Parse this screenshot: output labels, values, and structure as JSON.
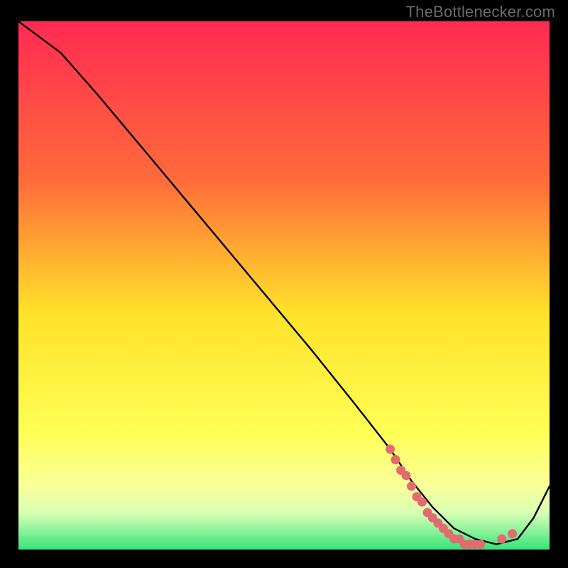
{
  "attribution": "TheBottlenecker.com",
  "colors": {
    "bg": "#000000",
    "gradient_top": "#ff2a52",
    "gradient_mid_upper": "#ff8b33",
    "gradient_mid": "#ffe12a",
    "gradient_lower": "#ffff70",
    "gradient_pale": "#f6ffb8",
    "gradient_bottom": "#36e579",
    "line": "#000000",
    "marker": "#e26b6f",
    "attrib_text": "#6a6a6a"
  },
  "chart_data": {
    "type": "line",
    "title": "",
    "xlabel": "",
    "ylabel": "",
    "xlim": [
      0,
      100
    ],
    "ylim": [
      0,
      100
    ],
    "series": [
      {
        "name": "curve",
        "x": [
          0,
          4,
          8,
          15,
          25,
          35,
          45,
          55,
          63,
          70,
          74,
          78,
          82,
          86,
          90,
          94,
          97,
          100
        ],
        "y": [
          100,
          97,
          94,
          86,
          74,
          62,
          50,
          38,
          28,
          19,
          13,
          8,
          4,
          2,
          1,
          2,
          6,
          12
        ]
      }
    ],
    "markers": {
      "name": "highlight-points",
      "x": [
        70,
        71,
        72,
        73,
        74,
        75,
        76,
        77,
        78,
        79,
        80,
        81,
        82,
        83,
        84,
        85,
        86,
        87,
        91,
        93
      ],
      "y": [
        19,
        17,
        15,
        14,
        12,
        10,
        9,
        7,
        6,
        5,
        4,
        3,
        2,
        2,
        1,
        1,
        1,
        1,
        2,
        3
      ]
    }
  }
}
